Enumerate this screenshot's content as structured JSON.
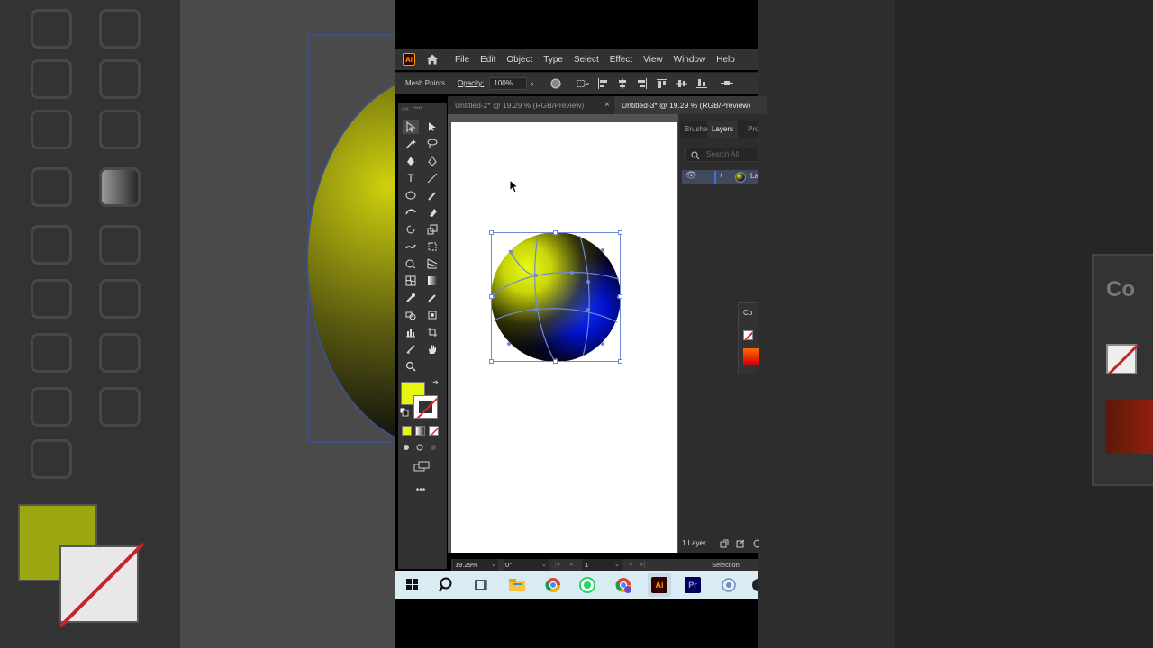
{
  "app": {
    "logo_text": "Ai",
    "menu": [
      "File",
      "Edit",
      "Object",
      "Type",
      "Select",
      "Effect",
      "View",
      "Window",
      "Help"
    ]
  },
  "control_bar": {
    "mode_label": "Mesh Points",
    "opacity_label": "Opacity:",
    "opacity_value": "100%"
  },
  "tabs": [
    {
      "label": "Untitled-2* @ 19.29 % (RGB/Preview)",
      "active": false,
      "close": "×"
    },
    {
      "label": "Untitled-3* @ 19.29 % (RGB/Preview)",
      "active": true
    }
  ],
  "panel": {
    "tabs": [
      "Brushe",
      "Layers",
      "Pro"
    ],
    "search_placeholder": "Search All",
    "layer_name": "La",
    "layer_count": "1 Layer"
  },
  "color_panel": {
    "title": "Co"
  },
  "statusbar": {
    "zoom": "19.29%",
    "rotation": "0°",
    "page": "1",
    "tool": "Selection"
  },
  "backdrop": {
    "panel_title": "Co"
  },
  "colors": {
    "fill": "#e5f70f",
    "sphere_yellow": "#e8fb10",
    "sphere_blue": "#1030ff",
    "selection": "#6e89d8"
  },
  "taskbar": [
    "windows-start",
    "search",
    "task-view",
    "file-explorer",
    "chrome",
    "whatsapp",
    "chrome-profile",
    "illustrator",
    "premiere",
    "app"
  ]
}
